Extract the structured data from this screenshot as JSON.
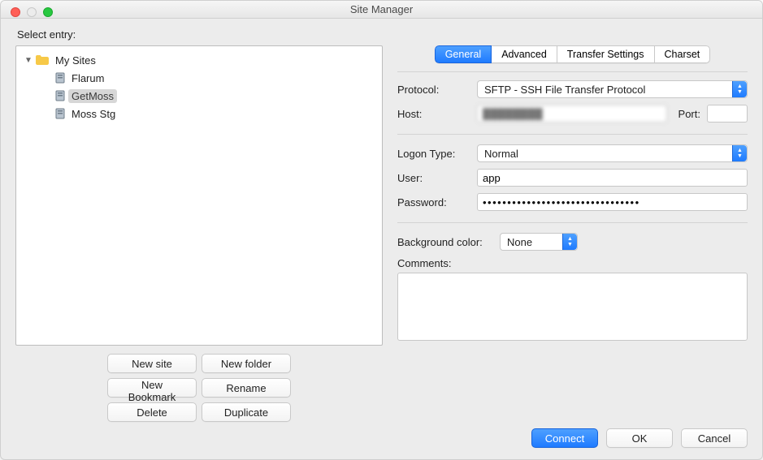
{
  "window": {
    "title": "Site Manager"
  },
  "left": {
    "select_entry_label": "Select entry:",
    "root_label": "My Sites",
    "sites": [
      {
        "label": "Flarum",
        "selected": false
      },
      {
        "label": "GetMoss",
        "selected": true
      },
      {
        "label": "Moss Stg",
        "selected": false
      }
    ],
    "buttons": {
      "new_site": "New site",
      "new_folder": "New folder",
      "new_bookmark": "New Bookmark",
      "rename": "Rename",
      "delete": "Delete",
      "duplicate": "Duplicate"
    }
  },
  "tabs": {
    "general": "General",
    "advanced": "Advanced",
    "transfer": "Transfer Settings",
    "charset": "Charset"
  },
  "form": {
    "protocol_label": "Protocol:",
    "protocol_value": "SFTP - SSH File Transfer Protocol",
    "host_label": "Host:",
    "host_value": "████████",
    "port_label": "Port:",
    "port_value": "",
    "logon_label": "Logon Type:",
    "logon_value": "Normal",
    "user_label": "User:",
    "user_value": "app",
    "password_label": "Password:",
    "password_value": "••••••••••••••••••••••••••••••••",
    "bgcolor_label": "Background color:",
    "bgcolor_value": "None",
    "comments_label": "Comments:",
    "comments_value": ""
  },
  "footer": {
    "connect": "Connect",
    "ok": "OK",
    "cancel": "Cancel"
  }
}
